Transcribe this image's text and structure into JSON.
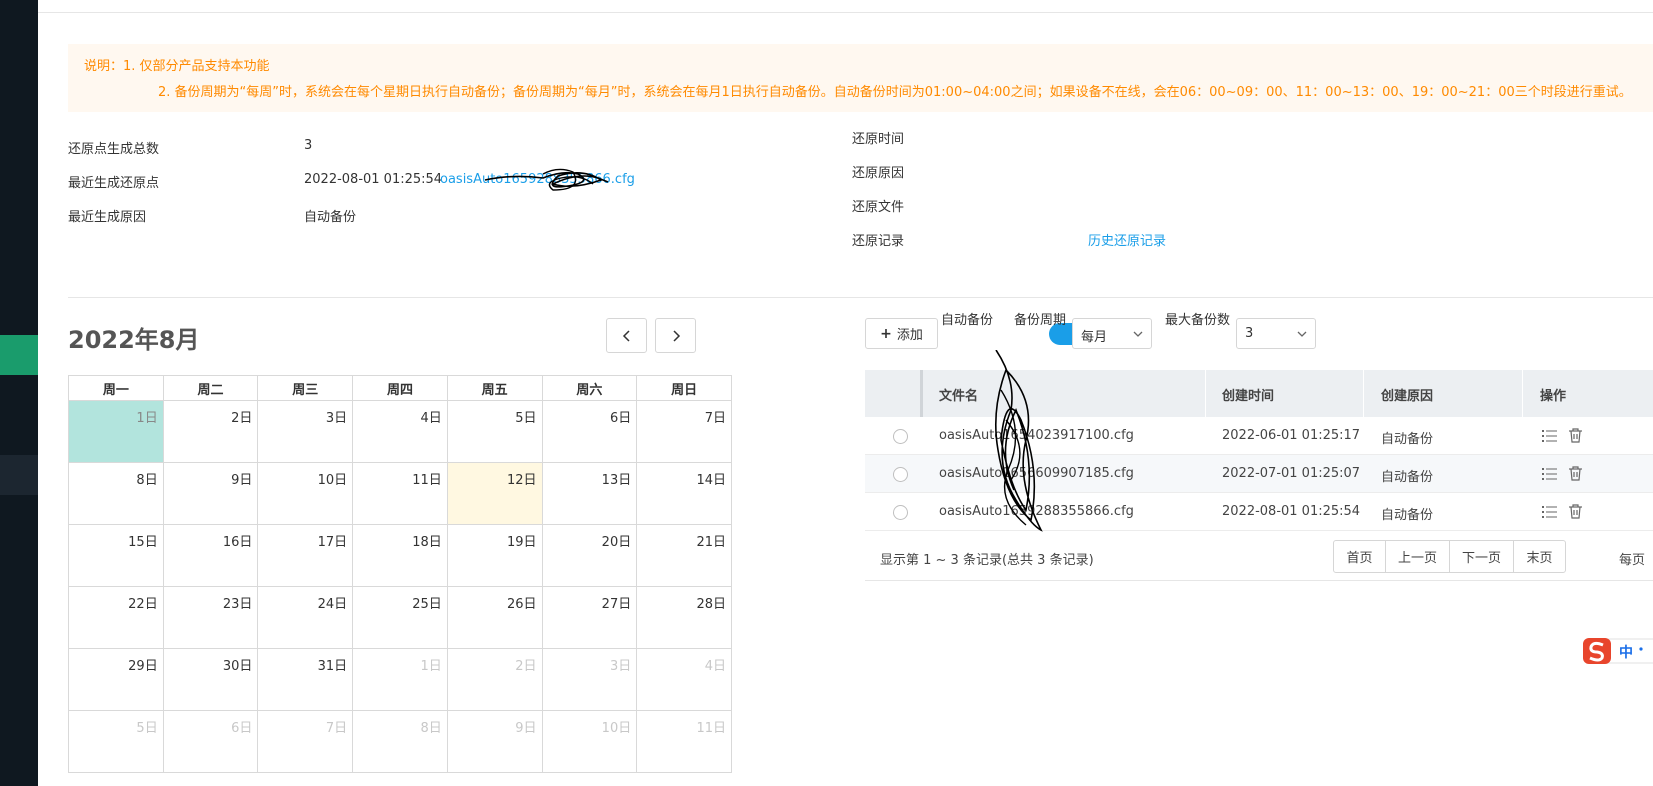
{
  "notice": {
    "line1": "说明：1. 仅部分产品支持本功能",
    "line2": "2. 备份周期为“每周”时，系统会在每个星期日执行自动备份；备份周期为“每月”时，系统会在每月1日执行自动备份。自动备份时间为01:00~04:00之间；如果设备不在线，会在06：00~09：00、11：00~13：00、19：00~21：00三个时段进行重试。"
  },
  "summary": {
    "total_label": "还原点生成总数",
    "total_value": "3",
    "latest_label": "最近生成还原点",
    "latest_time": "2022-08-01 01:25:54",
    "latest_file": "oasisAuto1659288355866.cfg",
    "reason_label": "最近生成原因",
    "reason_value": "自动备份"
  },
  "restore": {
    "time_label": "还原时间",
    "reason_label": "还原原因",
    "file_label": "还原文件",
    "record_label": "还原记录",
    "record_link": "历史还原记录"
  },
  "calendar": {
    "title": "2022年8月",
    "weekdays": [
      "周一",
      "周二",
      "周三",
      "周四",
      "周五",
      "周六",
      "周日"
    ],
    "weeks": [
      [
        {
          "d": "1日",
          "s": "selected"
        },
        {
          "d": "2日"
        },
        {
          "d": "3日"
        },
        {
          "d": "4日"
        },
        {
          "d": "5日"
        },
        {
          "d": "6日"
        },
        {
          "d": "7日"
        }
      ],
      [
        {
          "d": "8日"
        },
        {
          "d": "9日"
        },
        {
          "d": "10日"
        },
        {
          "d": "11日"
        },
        {
          "d": "12日",
          "s": "today"
        },
        {
          "d": "13日"
        },
        {
          "d": "14日"
        }
      ],
      [
        {
          "d": "15日"
        },
        {
          "d": "16日"
        },
        {
          "d": "17日"
        },
        {
          "d": "18日"
        },
        {
          "d": "19日"
        },
        {
          "d": "20日"
        },
        {
          "d": "21日"
        }
      ],
      [
        {
          "d": "22日"
        },
        {
          "d": "23日"
        },
        {
          "d": "24日"
        },
        {
          "d": "25日"
        },
        {
          "d": "26日"
        },
        {
          "d": "27日"
        },
        {
          "d": "28日"
        }
      ],
      [
        {
          "d": "29日"
        },
        {
          "d": "30日"
        },
        {
          "d": "31日"
        },
        {
          "d": "1日",
          "s": "other"
        },
        {
          "d": "2日",
          "s": "other"
        },
        {
          "d": "3日",
          "s": "other"
        },
        {
          "d": "4日",
          "s": "other"
        }
      ],
      [
        {
          "d": "5日",
          "s": "other"
        },
        {
          "d": "6日",
          "s": "other"
        },
        {
          "d": "7日",
          "s": "other"
        },
        {
          "d": "8日",
          "s": "other"
        },
        {
          "d": "9日",
          "s": "other"
        },
        {
          "d": "10日",
          "s": "other"
        },
        {
          "d": "11日",
          "s": "other"
        }
      ]
    ]
  },
  "toolbar": {
    "add_label": "添加",
    "auto_backup_label": "自动备份",
    "auto_backup_on": true,
    "period_label": "备份周期",
    "period_value": "每月",
    "max_label": "最大备份数",
    "max_value": "3"
  },
  "table": {
    "columns": [
      "文件名",
      "创建时间",
      "创建原因",
      "操作"
    ],
    "rows": [
      {
        "file": "oasisAuto1654023917100.cfg",
        "time": "2022-06-01 01:25:17",
        "reason": "自动备份"
      },
      {
        "file": "oasisAuto1656609907185.cfg",
        "time": "2022-07-01 01:25:07",
        "reason": "自动备份"
      },
      {
        "file": "oasisAuto1659288355866.cfg",
        "time": "2022-08-01 01:25:54",
        "reason": "自动备份"
      }
    ]
  },
  "pagination": {
    "summary": "显示第 1 ~ 3 条记录(总共 3 条记录)",
    "first": "首页",
    "prev": "上一页",
    "next": "下一页",
    "last": "末页",
    "per_page": "每页"
  },
  "ime": {
    "label": "中"
  },
  "colors": {
    "accent": "#1a9ee8",
    "notice": "#ff8a00",
    "sidebar": "#0f1820",
    "sidebar_active": "#1a9c6c"
  }
}
